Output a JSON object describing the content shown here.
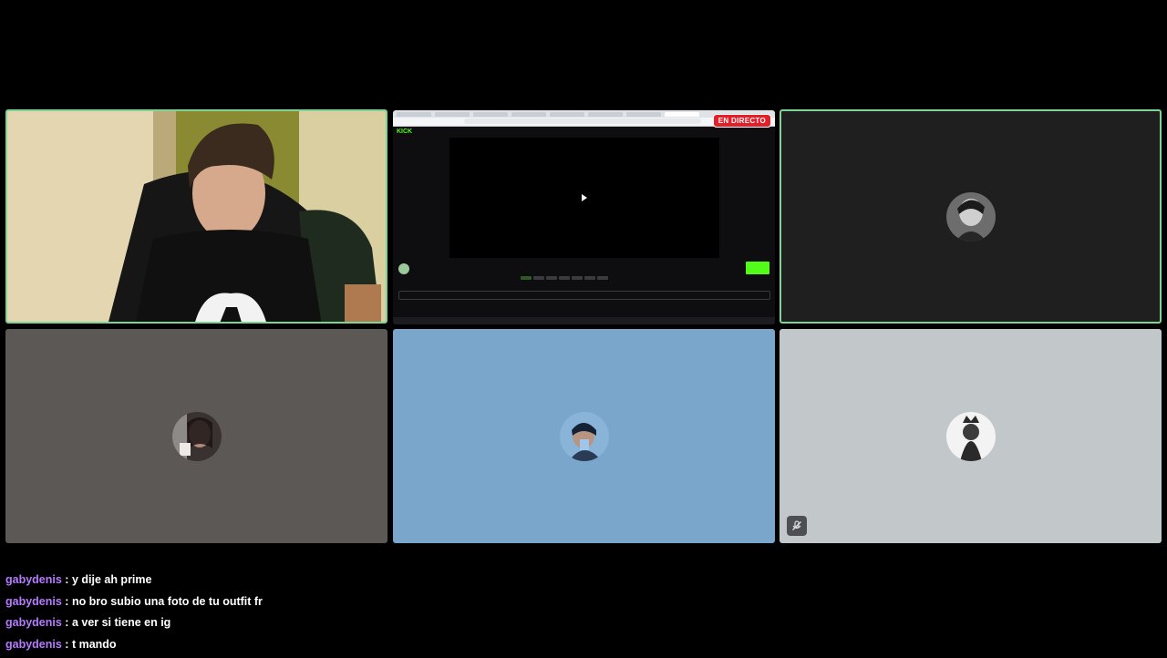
{
  "screen_share": {
    "live_badge": "EN DIRECTO",
    "site_logo": "KICK"
  },
  "participants": [
    {
      "id": "webcam",
      "active": true,
      "bg": "#7c7451"
    },
    {
      "id": "screen-share",
      "active": false,
      "bg": "#0e0e10"
    },
    {
      "id": "participant-3",
      "active": true,
      "bg": "#1f1f1f"
    },
    {
      "id": "participant-4",
      "active": false,
      "bg": "#5c5855"
    },
    {
      "id": "participant-5",
      "active": false,
      "bg": "#7ba6cc"
    },
    {
      "id": "participant-6",
      "active": false,
      "bg": "#c2c7ca",
      "muted": true
    }
  ],
  "chat": {
    "username_color": "#b57bff",
    "messages": [
      {
        "user": "gabydenis",
        "text": "y dije ah prime"
      },
      {
        "user": "gabydenis",
        "text": "no bro subio una foto de tu outfit fr"
      },
      {
        "user": "gabydenis",
        "text": "a ver si tiene en ig"
      },
      {
        "user": "gabydenis",
        "text": "t mando"
      }
    ]
  },
  "icons": {
    "mute": "microphone-muted-icon"
  }
}
